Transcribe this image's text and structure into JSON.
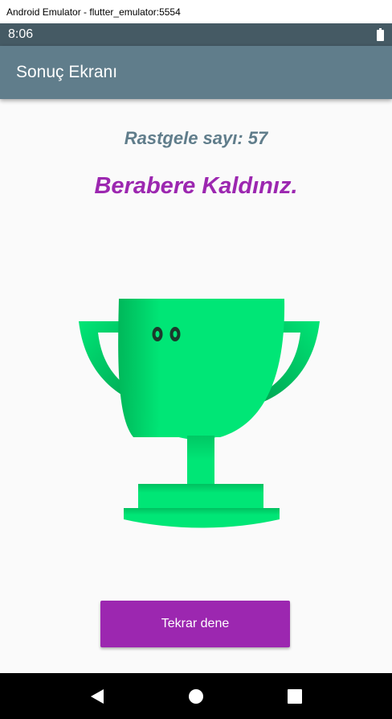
{
  "window": {
    "title": "Android Emulator - flutter_emulator:5554"
  },
  "statusbar": {
    "time": "8:06"
  },
  "appbar": {
    "title": "Sonuç Ekranı"
  },
  "main": {
    "random_number_text": "Rastgele sayı: 57",
    "result_text": "Berabere Kaldınız.",
    "trophy_icon": "trophy-icon",
    "retry_label": "Tekrar dene"
  },
  "navbar": {
    "icons": [
      "back-icon",
      "home-icon",
      "recents-icon"
    ]
  },
  "colors": {
    "statusbar": "#455a64",
    "appbar": "#607d8b",
    "accent": "#9c27b0",
    "trophy": "#00e676",
    "background": "#fafafa"
  }
}
